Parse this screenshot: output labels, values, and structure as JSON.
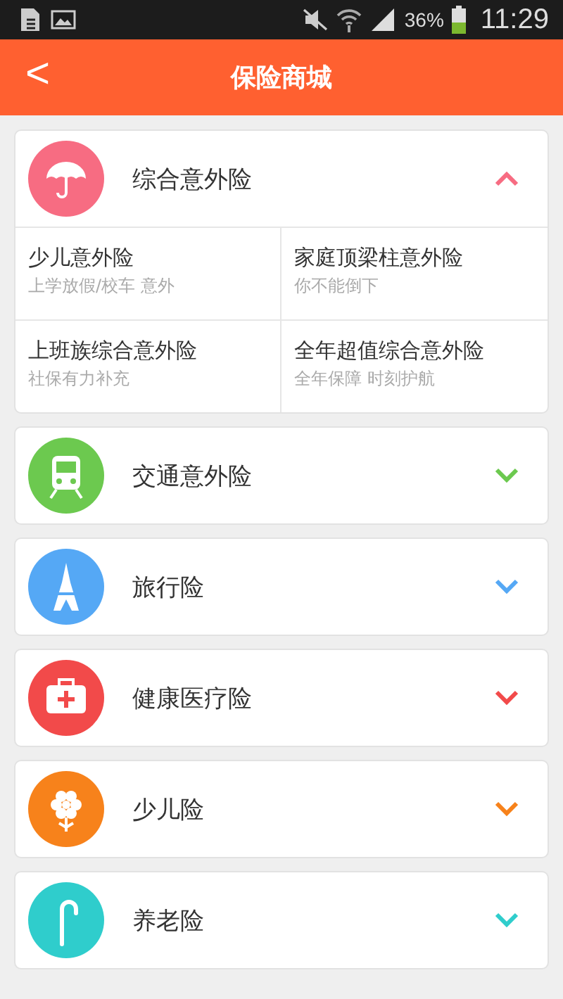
{
  "status_bar": {
    "battery_text": "36%",
    "time": "11:29"
  },
  "header": {
    "back": "<",
    "title": "保险商城"
  },
  "categories": [
    {
      "name": "综合意外险",
      "kind": "umbrella",
      "color": "#f76c82",
      "expanded": true,
      "products": [
        {
          "name": "少儿意外险",
          "subtitle": "上学放假/校车 意外"
        },
        {
          "name": "家庭顶梁柱意外险",
          "subtitle": "你不能倒下"
        },
        {
          "name": "上班族综合意外险",
          "subtitle": "社保有力补充"
        },
        {
          "name": "全年超值综合意外险",
          "subtitle": "全年保障 时刻护航"
        }
      ]
    },
    {
      "name": "交通意外险",
      "kind": "train",
      "color": "#6cc94f",
      "expanded": false
    },
    {
      "name": "旅行险",
      "kind": "tower",
      "color": "#55a8f5",
      "expanded": false
    },
    {
      "name": "健康医疗险",
      "kind": "medkit",
      "color": "#f24a4a",
      "expanded": false
    },
    {
      "name": "少儿险",
      "kind": "flower",
      "color": "#f7821b",
      "expanded": false
    },
    {
      "name": "养老险",
      "kind": "cane",
      "color": "#2fcdcc",
      "expanded": false
    }
  ]
}
